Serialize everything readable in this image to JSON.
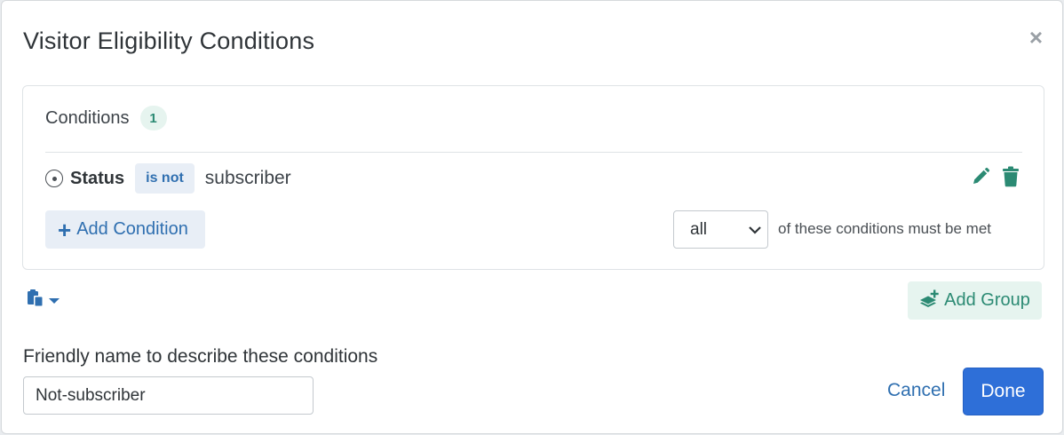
{
  "modal": {
    "title": "Visitor Eligibility Conditions",
    "close_glyph": "×"
  },
  "conditions": {
    "header_label": "Conditions",
    "count": "1",
    "items": [
      {
        "icon": "target-icon",
        "field": "Status",
        "operator": "is not",
        "value": "subscriber",
        "actions": [
          "pencil-icon",
          "trash-icon"
        ]
      }
    ],
    "add_condition_label": "Add Condition",
    "match_select": {
      "value": "all",
      "suffix_text": "of these conditions must be met"
    }
  },
  "toolbar": {
    "clipboard_icon": "clipboard-icon",
    "add_group_label": "Add Group",
    "add_group_icon": "layer-plus-icon"
  },
  "friendly_name": {
    "label": "Friendly name to describe these conditions",
    "value": "Not-subscriber"
  },
  "footer": {
    "cancel_label": "Cancel",
    "done_label": "Done"
  },
  "colors": {
    "primary": "#2e6fd8",
    "link": "#2f6fb0",
    "teal": "#2b8a73"
  }
}
